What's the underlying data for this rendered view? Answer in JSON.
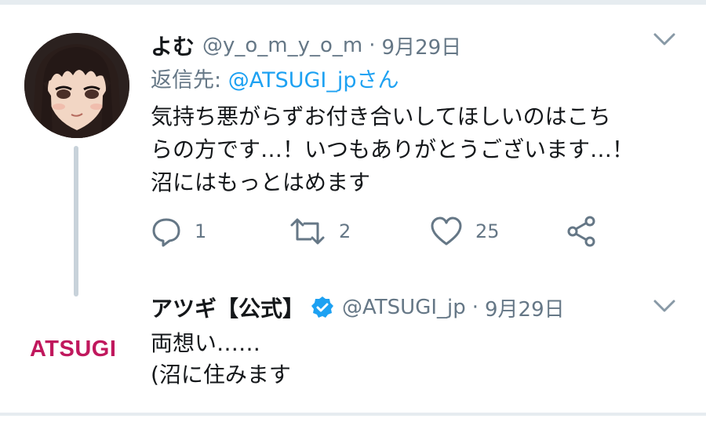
{
  "tweets": [
    {
      "author_name": "よむ",
      "handle": "@y_o_m_y_o_m",
      "separator": "·",
      "date": "9月29日",
      "reply_prefix": "返信先:",
      "reply_mention": "@ATSUGI_jpさん",
      "text": "気持ち悪がらずお付き合いしてほしいのはこち\nらの方です…！いつもありがとうございます…！\n沼にはもっとはめます",
      "counts": {
        "reply": "1",
        "retweet": "2",
        "like": "25"
      }
    },
    {
      "author_name": "アツギ【公式】",
      "handle": "@ATSUGI_jp",
      "separator": "·",
      "date": "9月29日",
      "logo_text": "ATSUGI",
      "text": "両想い……\n(沼に住みます"
    }
  ],
  "colors": {
    "link": "#1da1f2",
    "secondary": "#657786",
    "brand_logo": "#c0185d",
    "verified": "#1da1f2"
  },
  "icons": [
    "reply-icon",
    "retweet-icon",
    "like-icon",
    "share-icon",
    "chevron-down-icon",
    "verified-badge-icon"
  ]
}
